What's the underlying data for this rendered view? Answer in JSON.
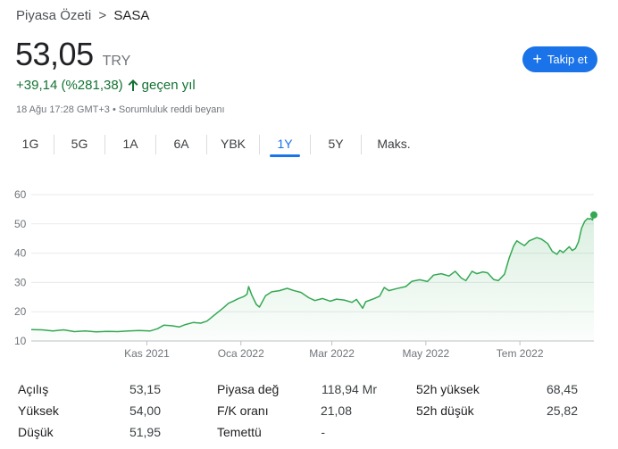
{
  "breadcrumb": {
    "parent": "Piyasa Özeti",
    "separator": ">",
    "current": "SASA"
  },
  "quote": {
    "price": "53,05",
    "currency": "TRY",
    "change": "+39,14 (%281,38)",
    "change_direction": "up",
    "period": "geçen yıl",
    "timestamp": "18 Ağu 17:28 GMT+3",
    "bullet": "•",
    "disclaimer": "Sorumluluk reddi beyanı"
  },
  "follow_button": {
    "label": "Takip et",
    "icon": "plus-icon"
  },
  "tabs": [
    {
      "label": "1G",
      "active": false
    },
    {
      "label": "5G",
      "active": false
    },
    {
      "label": "1A",
      "active": false
    },
    {
      "label": "6A",
      "active": false
    },
    {
      "label": "YBK",
      "active": false
    },
    {
      "label": "1Y",
      "active": true
    },
    {
      "label": "5Y",
      "active": false
    },
    {
      "label": "Maks.",
      "active": false
    }
  ],
  "colors": {
    "accent": "#1a73e8",
    "positive": "#137333",
    "line": "#34a853",
    "grid": "#e8eaed"
  },
  "chart_data": {
    "type": "area",
    "ylim": [
      10,
      60
    ],
    "yticks": [
      10,
      20,
      30,
      40,
      50,
      60
    ],
    "xticks": [
      "Kas 2021",
      "Oca 2022",
      "Mar 2022",
      "May 2022",
      "Tem 2022"
    ],
    "xtick_dates": [
      "2021-11-01",
      "2022-01-01",
      "2022-03-01",
      "2022-05-01",
      "2022-07-01"
    ],
    "x_range": [
      "2021-08-18",
      "2022-08-18"
    ],
    "grid": true,
    "series": [
      {
        "points": [
          [
            "2021-08-18",
            13.9
          ],
          [
            "2021-08-25",
            13.8
          ],
          [
            "2021-09-01",
            13.4
          ],
          [
            "2021-09-08",
            13.8
          ],
          [
            "2021-09-15",
            13.2
          ],
          [
            "2021-09-22",
            13.4
          ],
          [
            "2021-09-29",
            13.1
          ],
          [
            "2021-10-06",
            13.3
          ],
          [
            "2021-10-13",
            13.2
          ],
          [
            "2021-10-20",
            13.4
          ],
          [
            "2021-10-27",
            13.6
          ],
          [
            "2021-11-03",
            13.4
          ],
          [
            "2021-11-08",
            14.2
          ],
          [
            "2021-11-12",
            15.4
          ],
          [
            "2021-11-17",
            15.2
          ],
          [
            "2021-11-22",
            14.8
          ],
          [
            "2021-11-26",
            15.6
          ],
          [
            "2021-12-01",
            16.3
          ],
          [
            "2021-12-06",
            16.1
          ],
          [
            "2021-12-10",
            16.8
          ],
          [
            "2021-12-14",
            18.5
          ],
          [
            "2021-12-17",
            19.8
          ],
          [
            "2021-12-21",
            21.5
          ],
          [
            "2021-12-24",
            22.9
          ],
          [
            "2021-12-27",
            23.6
          ],
          [
            "2021-12-30",
            24.4
          ],
          [
            "2022-01-03",
            25.2
          ],
          [
            "2022-01-05",
            26.0
          ],
          [
            "2022-01-06",
            28.6
          ],
          [
            "2022-01-08",
            25.8
          ],
          [
            "2022-01-11",
            22.5
          ],
          [
            "2022-01-13",
            21.6
          ],
          [
            "2022-01-17",
            25.5
          ],
          [
            "2022-01-21",
            26.8
          ],
          [
            "2022-01-26",
            27.2
          ],
          [
            "2022-01-31",
            28.0
          ],
          [
            "2022-02-04",
            27.3
          ],
          [
            "2022-02-09",
            26.6
          ],
          [
            "2022-02-14",
            24.8
          ],
          [
            "2022-02-18",
            23.8
          ],
          [
            "2022-02-23",
            24.5
          ],
          [
            "2022-02-28",
            23.6
          ],
          [
            "2022-03-04",
            24.3
          ],
          [
            "2022-03-09",
            24.0
          ],
          [
            "2022-03-14",
            23.2
          ],
          [
            "2022-03-17",
            24.2
          ],
          [
            "2022-03-21",
            21.2
          ],
          [
            "2022-03-23",
            23.4
          ],
          [
            "2022-03-28",
            24.4
          ],
          [
            "2022-04-01",
            25.3
          ],
          [
            "2022-04-04",
            28.3
          ],
          [
            "2022-04-07",
            27.2
          ],
          [
            "2022-04-12",
            27.9
          ],
          [
            "2022-04-18",
            28.6
          ],
          [
            "2022-04-22",
            30.4
          ],
          [
            "2022-04-27",
            30.9
          ],
          [
            "2022-05-02",
            30.3
          ],
          [
            "2022-05-06",
            32.5
          ],
          [
            "2022-05-11",
            33.0
          ],
          [
            "2022-05-16",
            32.2
          ],
          [
            "2022-05-20",
            33.8
          ],
          [
            "2022-05-24",
            31.5
          ],
          [
            "2022-05-27",
            30.6
          ],
          [
            "2022-05-31",
            33.8
          ],
          [
            "2022-06-03",
            33.0
          ],
          [
            "2022-06-07",
            33.6
          ],
          [
            "2022-06-10",
            33.3
          ],
          [
            "2022-06-14",
            31.0
          ],
          [
            "2022-06-17",
            30.6
          ],
          [
            "2022-06-21",
            32.8
          ],
          [
            "2022-06-24",
            38.3
          ],
          [
            "2022-06-27",
            42.5
          ],
          [
            "2022-06-29",
            44.2
          ],
          [
            "2022-07-01",
            43.5
          ],
          [
            "2022-07-04",
            42.6
          ],
          [
            "2022-07-07",
            44.2
          ],
          [
            "2022-07-12",
            45.3
          ],
          [
            "2022-07-15",
            44.8
          ],
          [
            "2022-07-19",
            43.3
          ],
          [
            "2022-07-22",
            40.6
          ],
          [
            "2022-07-25",
            39.6
          ],
          [
            "2022-07-27",
            41.0
          ],
          [
            "2022-07-29",
            40.2
          ],
          [
            "2022-08-02",
            42.2
          ],
          [
            "2022-08-04",
            40.9
          ],
          [
            "2022-08-06",
            41.6
          ],
          [
            "2022-08-08",
            43.8
          ],
          [
            "2022-08-10",
            48.5
          ],
          [
            "2022-08-12",
            50.8
          ],
          [
            "2022-08-14",
            51.9
          ],
          [
            "2022-08-15",
            51.6
          ],
          [
            "2022-08-16",
            51.9
          ],
          [
            "2022-08-17",
            51.3
          ],
          [
            "2022-08-18",
            53.05
          ]
        ]
      }
    ]
  },
  "stats": [
    {
      "label": "Açılış",
      "value": "53,15"
    },
    {
      "label": "Yüksek",
      "value": "54,00"
    },
    {
      "label": "Düşük",
      "value": "51,95"
    },
    {
      "label": "Piyasa değ",
      "value": "118,94 Mr"
    },
    {
      "label": "F/K oranı",
      "value": "21,08"
    },
    {
      "label": "Temettü",
      "value": "-"
    },
    {
      "label": "52h yüksek",
      "value": "68,45"
    },
    {
      "label": "52h düşük",
      "value": "25,82"
    }
  ]
}
